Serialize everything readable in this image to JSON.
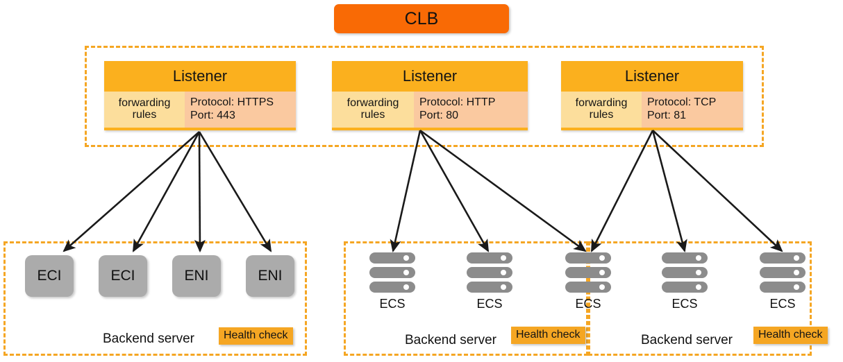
{
  "diagram": {
    "title_box": {
      "label": "CLB"
    },
    "colors": {
      "clb_orange": "#F96A05",
      "listener_header": "#FBB01E",
      "forwarding_rules": "#FCDE9C",
      "protocol_panel": "#FAC9A0",
      "dashed_border": "#F5A623",
      "node_gray": "#ABABAB",
      "server_gray": "#8C8C8C",
      "health_badge": "#F5A623",
      "arrow": "#1a1a1a"
    },
    "listeners_group": {
      "items": [
        {
          "title": "Listener",
          "rules_label": "forwarding\nrules",
          "rules_line1": "forwarding",
          "rules_line2": "rules",
          "protocol_line": "Protocol: HTTPS",
          "port_line": "Port:  443"
        },
        {
          "title": "Listener",
          "rules_line1": "forwarding",
          "rules_line2": "rules",
          "protocol_line": "Protocol: HTTP",
          "port_line": "Port:  80"
        },
        {
          "title": "Listener",
          "rules_line1": "forwarding",
          "rules_line2": "rules",
          "protocol_line": "Protocol: TCP",
          "port_line": "Port:  81"
        }
      ]
    },
    "backend_groups": [
      {
        "id": "left",
        "label": "Backend server",
        "health_check_label": "Health check",
        "node_type": "rounded-box",
        "nodes": [
          {
            "label": "ECI"
          },
          {
            "label": "ECI"
          },
          {
            "label": "ENI"
          },
          {
            "label": "ENI"
          }
        ]
      },
      {
        "id": "middle",
        "label": "Backend server",
        "health_check_label": "Health check",
        "node_type": "server-stack",
        "nodes": [
          {
            "label": "ECS"
          },
          {
            "label": "ECS"
          },
          {
            "label": "ECS"
          }
        ]
      },
      {
        "id": "right",
        "label": "Backend server",
        "health_check_label": "Health check",
        "node_type": "server-stack",
        "nodes": [
          {
            "label": "ECS"
          },
          {
            "label": "ECS"
          },
          {
            "label": "ECS"
          }
        ]
      }
    ]
  }
}
